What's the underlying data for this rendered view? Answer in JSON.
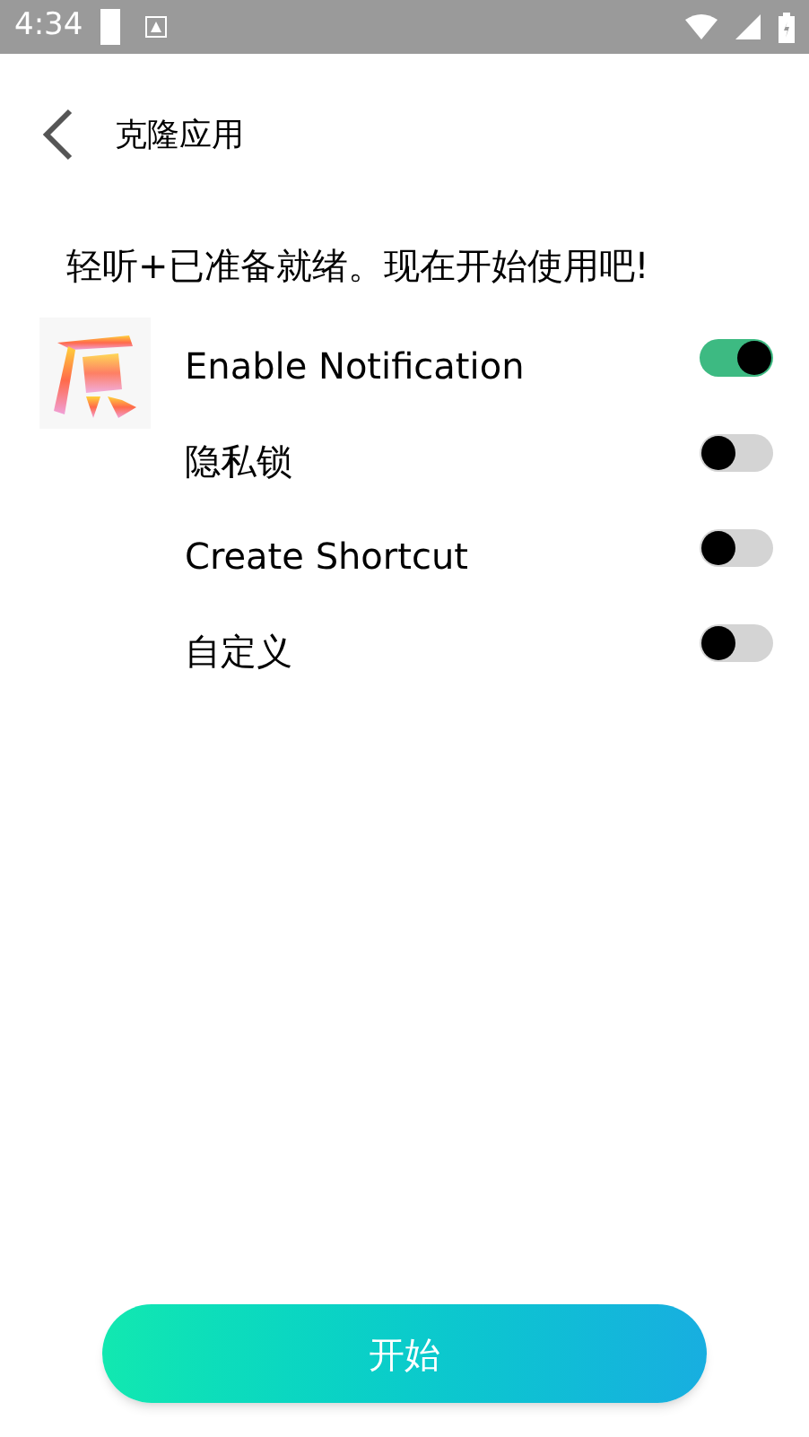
{
  "status_bar": {
    "time": "4:34"
  },
  "header": {
    "title": "克隆应用"
  },
  "message": "轻听+已准备就绪。现在开始使用吧!",
  "options": [
    {
      "label": "Enable Notification",
      "on": true
    },
    {
      "label": "隐私锁",
      "on": false
    },
    {
      "label": "Create Shortcut",
      "on": false
    },
    {
      "label": "自定义",
      "on": false
    }
  ],
  "start_button": {
    "label": "开始"
  }
}
